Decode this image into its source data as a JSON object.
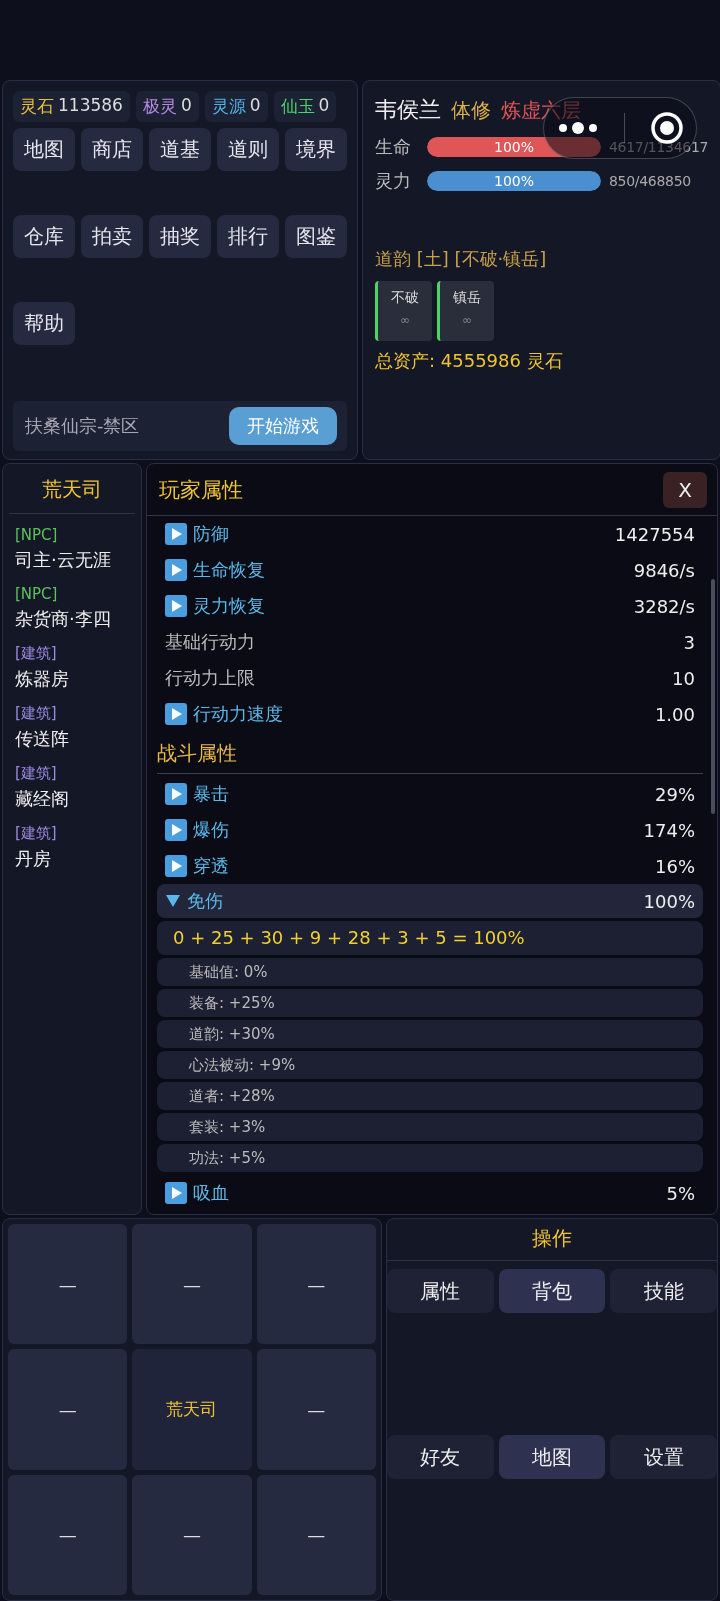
{
  "currencies": [
    {
      "label": "灵石",
      "value": "113586",
      "color": "#e8c33a"
    },
    {
      "label": "极灵",
      "value": "0",
      "color": "#b58ae0"
    },
    {
      "label": "灵源",
      "value": "0",
      "color": "#4fb3e6"
    },
    {
      "label": "仙玉",
      "value": "0",
      "color": "#4cd46a"
    }
  ],
  "menu_buttons": [
    "地图",
    "商店",
    "道基",
    "道则",
    "境界",
    "仓库",
    "拍卖",
    "抽奖",
    "排行",
    "图鉴",
    "帮助"
  ],
  "location": "扶桑仙宗-禁区",
  "start_button": "开始游戏",
  "player": {
    "name": "韦侯兰",
    "class": "体修",
    "realm": "炼虚六层",
    "bars": [
      {
        "label": "生命",
        "percent": "100%",
        "level": 1,
        "reading": "4617/1134617",
        "color": "#e05555"
      },
      {
        "label": "灵力",
        "percent": "100%",
        "level": 1,
        "reading": "850/468850",
        "color": "#4a8fd0"
      }
    ],
    "dao_title": "道韵 [土] [不破·镇岳]",
    "dao_cards": [
      {
        "name": "不破",
        "duration": "∞"
      },
      {
        "name": "镇岳",
        "duration": "∞"
      }
    ],
    "total_assets": "总资产: 4555986 灵石"
  },
  "location_panel": {
    "title": "荒天司",
    "entries": [
      {
        "kind": "npc",
        "tag": "[NPC]",
        "name": "司主·云无涯"
      },
      {
        "kind": "npc",
        "tag": "[NPC]",
        "name": "杂货商·李四"
      },
      {
        "kind": "building",
        "tag": "[建筑]",
        "name": "炼器房"
      },
      {
        "kind": "building",
        "tag": "[建筑]",
        "name": "传送阵"
      },
      {
        "kind": "building",
        "tag": "[建筑]",
        "name": "藏经阁"
      },
      {
        "kind": "building",
        "tag": "[建筑]",
        "name": "丹房"
      }
    ]
  },
  "attributes_modal": {
    "title": "玩家属性",
    "close": "X",
    "items": [
      {
        "kind": "stat",
        "label": "防御",
        "value": "1427554",
        "expandable": true,
        "expanded": false
      },
      {
        "kind": "stat",
        "label": "生命恢复",
        "value": "9846/s",
        "expandable": true,
        "expanded": false
      },
      {
        "kind": "stat",
        "label": "灵力恢复",
        "value": "3282/s",
        "expandable": true,
        "expanded": false
      },
      {
        "kind": "stat",
        "label": "基础行动力",
        "value": "3",
        "expandable": false,
        "expanded": false
      },
      {
        "kind": "stat",
        "label": "行动力上限",
        "value": "10",
        "expandable": false,
        "expanded": false
      },
      {
        "kind": "stat",
        "label": "行动力速度",
        "value": "1.00",
        "expandable": true,
        "expanded": false
      },
      {
        "kind": "heading",
        "label": "战斗属性"
      },
      {
        "kind": "stat",
        "label": "暴击",
        "value": "29%",
        "expandable": true,
        "expanded": false
      },
      {
        "kind": "stat",
        "label": "爆伤",
        "value": "174%",
        "expandable": true,
        "expanded": false
      },
      {
        "kind": "stat",
        "label": "穿透",
        "value": "16%",
        "expandable": true,
        "expanded": false
      },
      {
        "kind": "stat",
        "label": "免伤",
        "value": "100%",
        "expandable": true,
        "expanded": true
      },
      {
        "kind": "formula",
        "label": "0 + 25 + 30 + 9 + 28 + 3 + 5 = 100%"
      },
      {
        "kind": "detail",
        "label": "基础值: 0%"
      },
      {
        "kind": "detail",
        "label": "装备: +25%"
      },
      {
        "kind": "detail",
        "label": "道韵: +30%"
      },
      {
        "kind": "detail",
        "label": "心法被动: +9%"
      },
      {
        "kind": "detail",
        "label": "道者: +28%"
      },
      {
        "kind": "detail",
        "label": "套装: +3%"
      },
      {
        "kind": "detail",
        "label": "功法: +5%"
      },
      {
        "kind": "stat",
        "label": "吸血",
        "value": "5%",
        "expandable": true,
        "expanded": false
      }
    ]
  },
  "map_grid": [
    {
      "label": "—",
      "current": false
    },
    {
      "label": "—",
      "current": false
    },
    {
      "label": "—",
      "current": false
    },
    {
      "label": "—",
      "current": false
    },
    {
      "label": "荒天司",
      "current": true
    },
    {
      "label": "—",
      "current": false
    },
    {
      "label": "—",
      "current": false
    },
    {
      "label": "—",
      "current": false
    },
    {
      "label": "—",
      "current": false
    }
  ],
  "operations": {
    "title": "操作",
    "buttons": [
      {
        "label": "属性",
        "emphasized": false
      },
      {
        "label": "背包",
        "emphasized": true
      },
      {
        "label": "技能",
        "emphasized": false
      },
      {
        "label": "好友",
        "emphasized": false
      },
      {
        "label": "地图",
        "emphasized": true
      },
      {
        "label": "设置",
        "emphasized": false
      }
    ]
  }
}
